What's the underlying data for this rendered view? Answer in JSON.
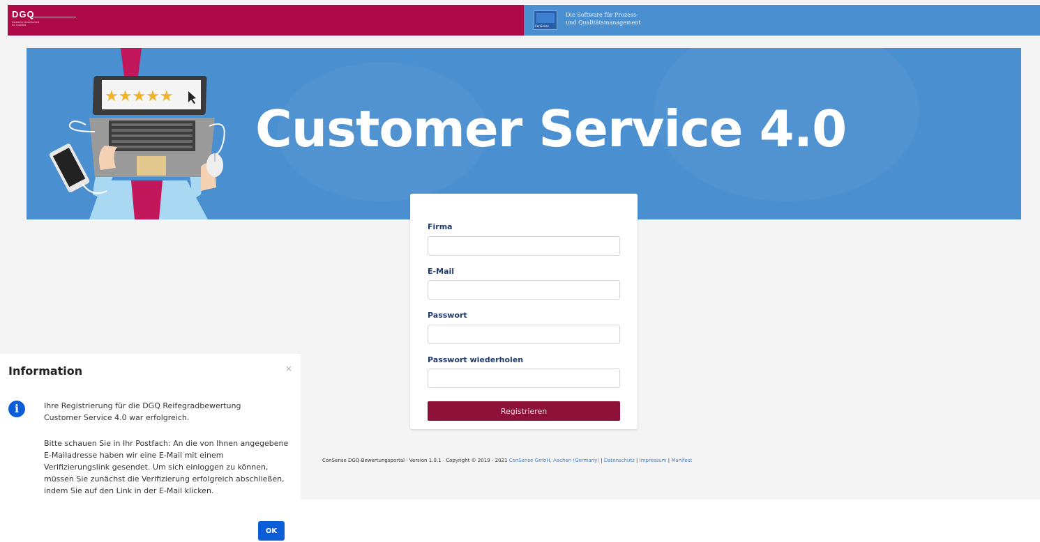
{
  "header": {
    "left_logo": "DGQ",
    "left_logo_sub": "Deutsche Gesellschaft für Qualität",
    "right_logo_text": "ConSense",
    "tagline_line1": "Die Software für Prozess-",
    "tagline_line2": "und Qualitätsmanagement"
  },
  "banner": {
    "title": "Customer Service 4.0"
  },
  "form": {
    "fields": [
      {
        "label": "Firma",
        "value": ""
      },
      {
        "label": "E-Mail",
        "value": ""
      },
      {
        "label": "Passwort",
        "value": ""
      },
      {
        "label": "Passwort wiederholen",
        "value": ""
      }
    ],
    "submit_label": "Registrieren"
  },
  "footer": {
    "text": "ConSense DGQ-Bewertungsportal · Version 1.0.1 · Copyright © 2019 - 2021 ",
    "company_link": "ConSense GmbH, Aachen (Germany)",
    "sep1": " | ",
    "privacy_link": "Datenschutz",
    "sep2": " | ",
    "imprint_link": "Impressum",
    "sep3": " | ",
    "manifest_link": "Manifest"
  },
  "dialog": {
    "title": "Information",
    "close": "×",
    "icon": "i",
    "para1_line1": "Ihre Registrierung für die DGQ Reifegradbewertung",
    "para1_line2": "Customer Service 4.0 war erfolgreich.",
    "para2_line1": "Bitte schauen Sie in Ihr Postfach: An die von Ihnen angegebene",
    "para2_line2": "E-Mailadresse haben wir eine E-Mail mit einem",
    "para2_line3": "Verifizierungslink gesendet. Um sich einloggen zu können,",
    "para2_line4": "müssen Sie zunächst die Verifizierung erfolgreich abschließen,",
    "para2_line5": "indem Sie auf den Link in der E-Mail klicken.",
    "ok_label": "OK"
  },
  "colors": {
    "brand_red": "#ae0a47",
    "brand_blue": "#4a90d0",
    "button_red": "#8c1038",
    "dialog_blue": "#0b5ed7"
  }
}
